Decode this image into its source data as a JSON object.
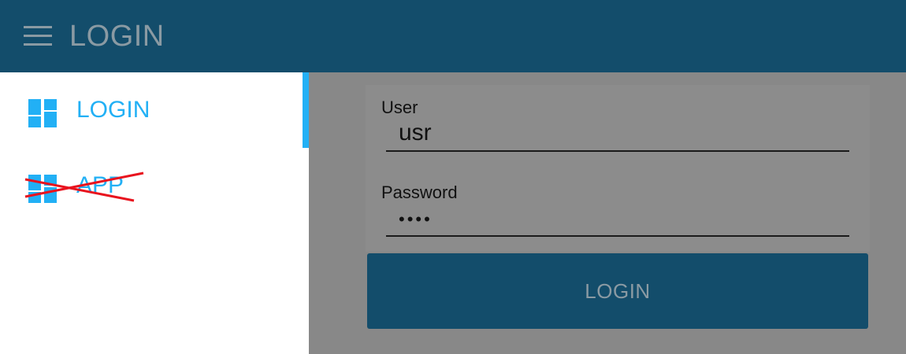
{
  "appbar": {
    "title": "LOGIN"
  },
  "drawer": {
    "items": [
      {
        "label": "LOGIN",
        "icon": "dashboard-icon",
        "active": true,
        "crossed_out": false
      },
      {
        "label": "APP",
        "icon": "dashboard-icon",
        "active": false,
        "crossed_out": true
      }
    ]
  },
  "form": {
    "user_label": "User",
    "user_value": "usr",
    "password_label": "Password",
    "password_value": "pass",
    "login_button_label": "LOGIN"
  },
  "colors": {
    "appbar": "#134d6b",
    "accent": "#22b0f5",
    "scrim": "#888888",
    "strike": "#e8131e"
  }
}
